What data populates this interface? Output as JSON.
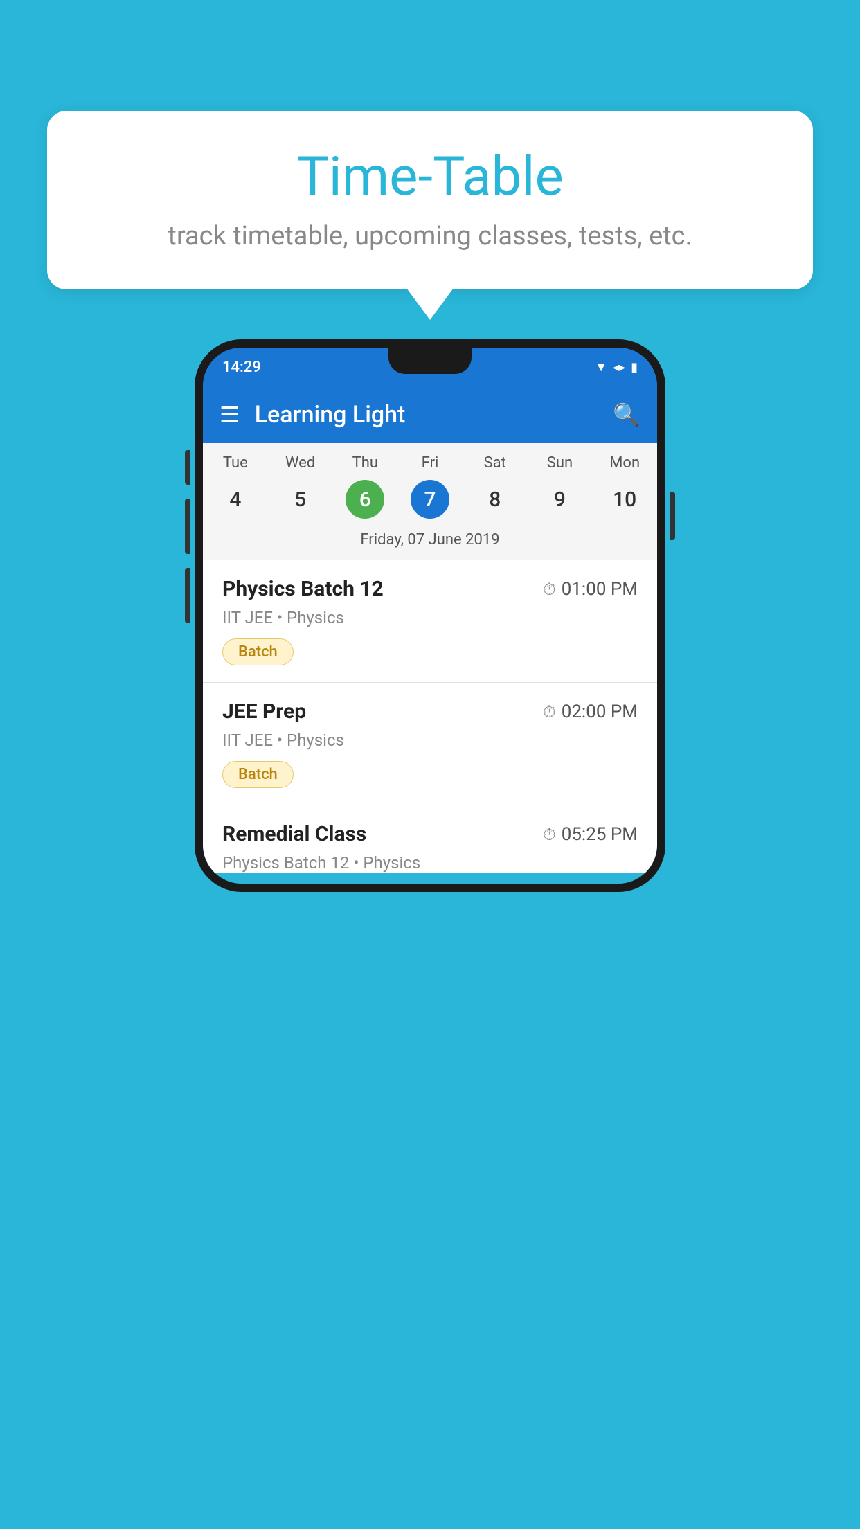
{
  "background_color": "#29b6d8",
  "bubble": {
    "title": "Time-Table",
    "subtitle": "track timetable, upcoming classes, tests, etc."
  },
  "phone": {
    "status_bar": {
      "time": "14:29"
    },
    "app_header": {
      "title": "Learning Light"
    },
    "calendar": {
      "days": [
        "Tue",
        "Wed",
        "Thu",
        "Fri",
        "Sat",
        "Sun",
        "Mon"
      ],
      "dates": [
        "4",
        "5",
        "6",
        "7",
        "8",
        "9",
        "10"
      ],
      "today_index": 2,
      "selected_index": 3,
      "selected_label": "Friday, 07 June 2019"
    },
    "classes": [
      {
        "name": "Physics Batch 12",
        "time": "01:00 PM",
        "meta": "IIT JEE • Physics",
        "badge": "Batch"
      },
      {
        "name": "JEE Prep",
        "time": "02:00 PM",
        "meta": "IIT JEE • Physics",
        "badge": "Batch"
      },
      {
        "name": "Remedial Class",
        "time": "05:25 PM",
        "meta": "Physics Batch 12 • Physics",
        "badge": ""
      }
    ]
  }
}
